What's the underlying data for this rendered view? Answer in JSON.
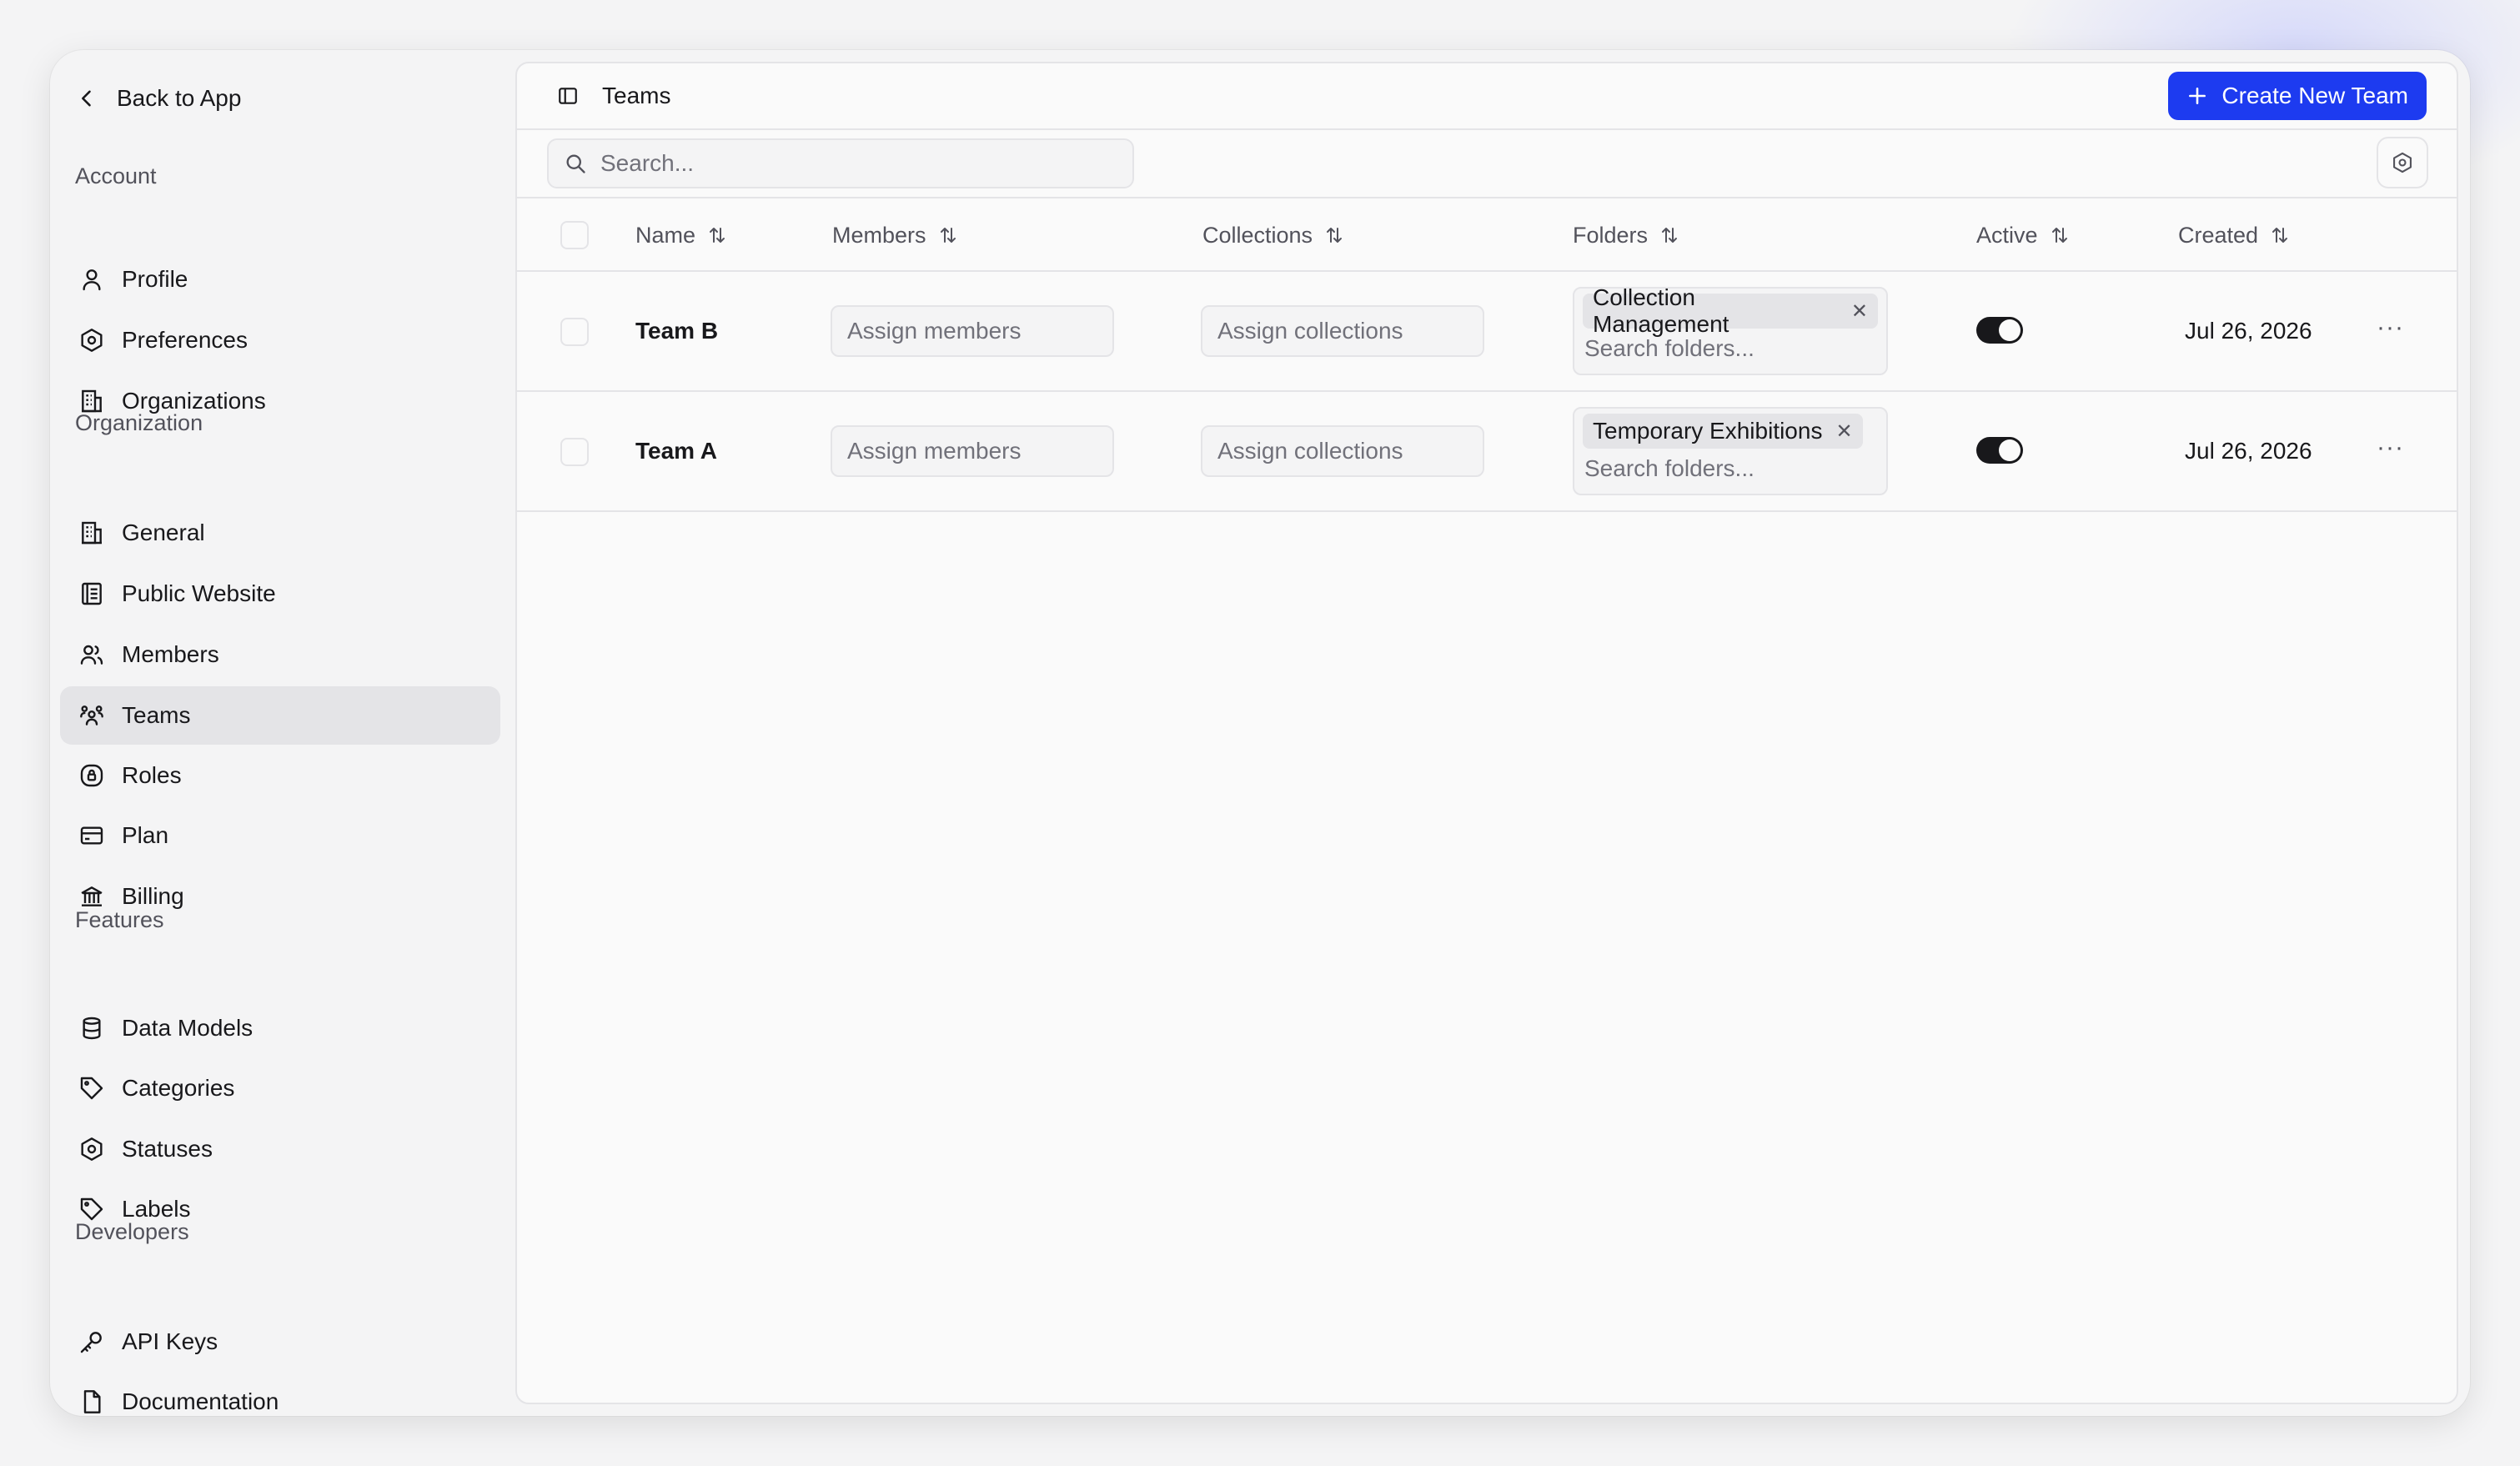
{
  "sidebar": {
    "back_label": "Back to App",
    "sections": [
      {
        "label": "Account",
        "items": [
          {
            "label": "Profile",
            "icon": "user-icon"
          },
          {
            "label": "Preferences",
            "icon": "hexagon-settings-icon"
          },
          {
            "label": "Organizations",
            "icon": "building-icon"
          }
        ]
      },
      {
        "label": "Organization",
        "items": [
          {
            "label": "General",
            "icon": "building-icon"
          },
          {
            "label": "Public Website",
            "icon": "website-icon"
          },
          {
            "label": "Members",
            "icon": "users-icon"
          },
          {
            "label": "Teams",
            "icon": "team-icon",
            "active": true
          },
          {
            "label": "Roles",
            "icon": "badge-lock-icon"
          },
          {
            "label": "Plan",
            "icon": "credit-card-icon"
          },
          {
            "label": "Billing",
            "icon": "bank-icon"
          }
        ]
      },
      {
        "label": "Features",
        "items": [
          {
            "label": "Data Models",
            "icon": "database-icon"
          },
          {
            "label": "Categories",
            "icon": "tag-icon"
          },
          {
            "label": "Statuses",
            "icon": "hexagon-settings-icon"
          },
          {
            "label": "Labels",
            "icon": "tag-icon"
          }
        ]
      },
      {
        "label": "Developers",
        "items": [
          {
            "label": "API Keys",
            "icon": "key-icon"
          },
          {
            "label": "Documentation",
            "icon": "file-icon"
          }
        ]
      }
    ]
  },
  "header": {
    "title": "Teams",
    "create_button_label": "Create New Team"
  },
  "search": {
    "placeholder": "Search..."
  },
  "table": {
    "columns": [
      "Name",
      "Members",
      "Collections",
      "Folders",
      "Active",
      "Created"
    ],
    "rows": [
      {
        "name": "Team B",
        "members_placeholder": "Assign members",
        "collections_placeholder": "Assign collections",
        "folder_chip": "Collection Management",
        "folder_search_placeholder": "Search folders...",
        "active": true,
        "created": "Jul 26, 2026"
      },
      {
        "name": "Team A",
        "members_placeholder": "Assign members",
        "collections_placeholder": "Assign collections",
        "folder_chip": "Temporary Exhibitions",
        "folder_search_placeholder": "Search folders...",
        "active": true,
        "created": "Jul 26, 2026"
      }
    ]
  },
  "colors": {
    "accent": "#1d3bf0",
    "active_nav_bg": "#e4e4e7",
    "toggle_on": "#18181b"
  }
}
